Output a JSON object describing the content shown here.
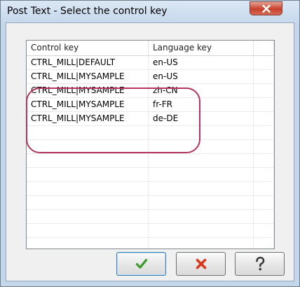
{
  "window": {
    "title": "Post Text - Select the control key"
  },
  "table": {
    "columns": [
      "Control key",
      "Language key"
    ],
    "rows": [
      {
        "control_key": "CTRL_MILL|DEFAULT",
        "language_key": "en-US"
      },
      {
        "control_key": "CTRL_MILL|MYSAMPLE",
        "language_key": "en-US"
      },
      {
        "control_key": "CTRL_MILL|MYSAMPLE",
        "language_key": "zh-CN"
      },
      {
        "control_key": "CTRL_MILL|MYSAMPLE",
        "language_key": "fr-FR"
      },
      {
        "control_key": "CTRL_MILL|MYSAMPLE",
        "language_key": "de-DE"
      }
    ]
  },
  "buttons": {
    "ok_icon": "checkmark-icon",
    "cancel_icon": "x-mark-icon",
    "help_icon": "question-mark-icon"
  },
  "colors": {
    "highlight": "#b3345d",
    "ok": "#3a9a28",
    "cancel": "#d9371c",
    "help": "#3a3a3a"
  }
}
